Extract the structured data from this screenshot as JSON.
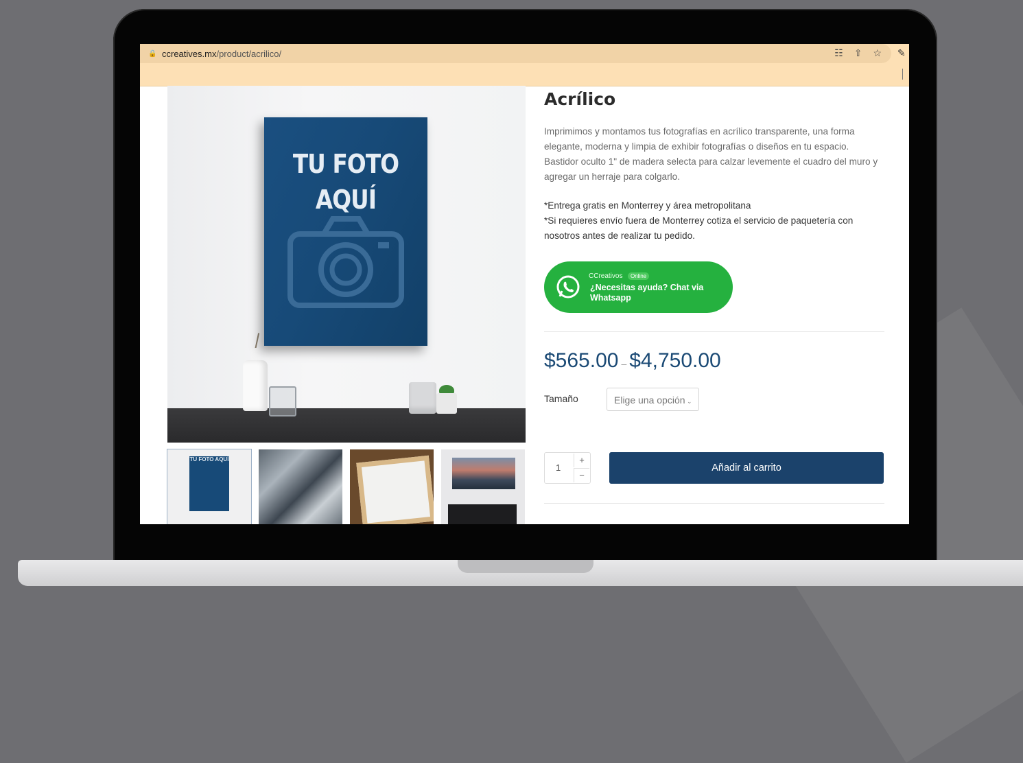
{
  "browser": {
    "url_domain": "ccreatives.mx",
    "url_path": "/product/acrilico/"
  },
  "gallery": {
    "frame_text_line1": "TU FOTO",
    "frame_text_line2": "AQUÍ",
    "thumb1_text": "TU FOTO AQUÍ"
  },
  "product": {
    "title": "Acrílico",
    "description": "Imprimimos y montamos tus fotografías en acrílico transparente, una forma elegante, moderna y limpia de exhibir fotografías o diseños en tu espacio. Bastidor oculto 1\" de madera selecta para calzar levemente el cuadro del muro y agregar un herraje para colgarlo.",
    "note1": "*Entrega gratis en Monterrey y área metropolitana",
    "note2": "*Si requieres envío fuera de Monterrey cotiza el servicio de paquetería con nosotros antes de realizar tu pedido.",
    "price_min": "$565.00",
    "price_sep": "–",
    "price_max": "$4,750.00",
    "size_label": "Tamaño",
    "size_select_value": "Elige una opción",
    "quantity": "1",
    "qty_plus": "+",
    "qty_minus": "−",
    "add_to_cart_label": "Añadir al carrito"
  },
  "whatsapp": {
    "name": "CCreativos",
    "status": "Online",
    "message": "¿Necesitas ayuda? Chat via Whatsapp",
    "color": "#25b13f"
  },
  "icons": {
    "lock": "lock-icon",
    "translate": "translate-icon",
    "share": "share-icon",
    "star": "bookmark-star-icon",
    "pen": "pen-icon",
    "whatsapp": "whatsapp-icon",
    "camera": "camera-icon"
  },
  "colors": {
    "address_bar": "#fde0b5",
    "brand_blue": "#1b426b",
    "price_blue": "#1b4a75"
  }
}
